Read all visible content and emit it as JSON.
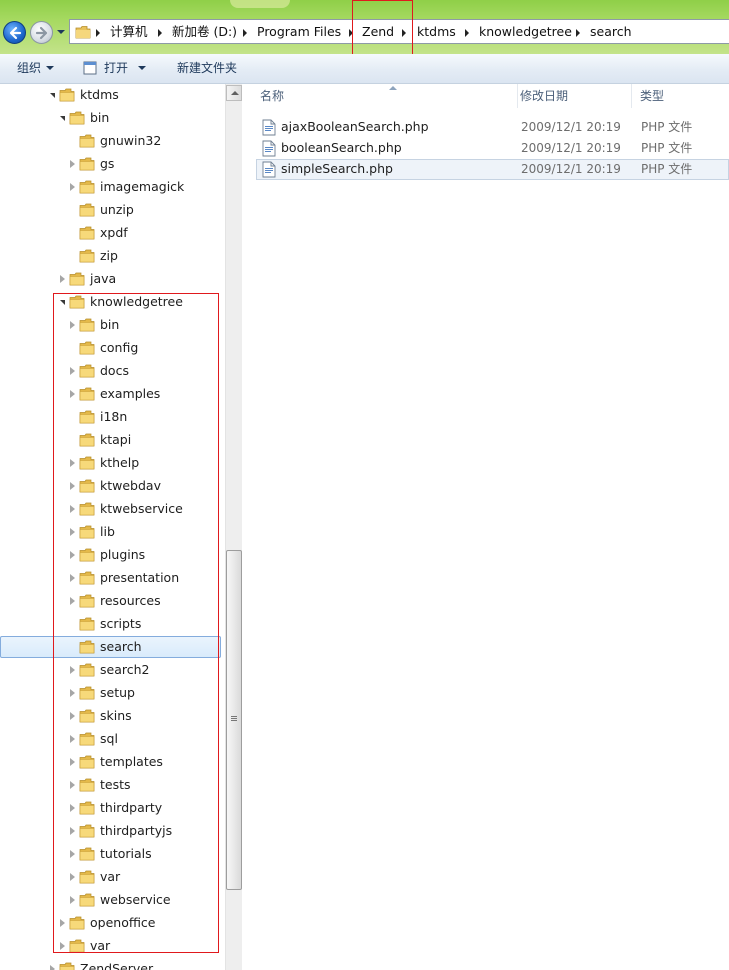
{
  "address": {
    "crumbs": [
      "计算机",
      "新加卷 (D:)",
      "Program Files",
      "Zend",
      "ktdms",
      "knowledgetree",
      "search"
    ]
  },
  "toolbar": {
    "organize": "组织",
    "open": "打开",
    "new_folder": "新建文件夹"
  },
  "tree": {
    "items": [
      {
        "label": "ktdms",
        "state": "expanded"
      },
      {
        "label": "bin",
        "state": "expanded"
      },
      {
        "label": "gnuwin32",
        "state": "none"
      },
      {
        "label": "gs",
        "state": "collapsed"
      },
      {
        "label": "imagemagick",
        "state": "collapsed"
      },
      {
        "label": "unzip",
        "state": "none"
      },
      {
        "label": "xpdf",
        "state": "none"
      },
      {
        "label": "zip",
        "state": "none"
      },
      {
        "label": "java",
        "state": "collapsed"
      },
      {
        "label": "knowledgetree",
        "state": "expanded"
      },
      {
        "label": "bin",
        "state": "collapsed"
      },
      {
        "label": "config",
        "state": "none"
      },
      {
        "label": "docs",
        "state": "collapsed"
      },
      {
        "label": "examples",
        "state": "collapsed"
      },
      {
        "label": "i18n",
        "state": "none"
      },
      {
        "label": "ktapi",
        "state": "none"
      },
      {
        "label": "kthelp",
        "state": "collapsed"
      },
      {
        "label": "ktwebdav",
        "state": "collapsed"
      },
      {
        "label": "ktwebservice",
        "state": "collapsed"
      },
      {
        "label": "lib",
        "state": "collapsed"
      },
      {
        "label": "plugins",
        "state": "collapsed"
      },
      {
        "label": "presentation",
        "state": "collapsed"
      },
      {
        "label": "resources",
        "state": "collapsed"
      },
      {
        "label": "scripts",
        "state": "none"
      },
      {
        "label": "search",
        "state": "none"
      },
      {
        "label": "search2",
        "state": "collapsed"
      },
      {
        "label": "setup",
        "state": "collapsed"
      },
      {
        "label": "skins",
        "state": "collapsed"
      },
      {
        "label": "sql",
        "state": "collapsed"
      },
      {
        "label": "templates",
        "state": "collapsed"
      },
      {
        "label": "tests",
        "state": "collapsed"
      },
      {
        "label": "thirdparty",
        "state": "collapsed"
      },
      {
        "label": "thirdpartyjs",
        "state": "collapsed"
      },
      {
        "label": "tutorials",
        "state": "collapsed"
      },
      {
        "label": "var",
        "state": "collapsed"
      },
      {
        "label": "webservice",
        "state": "collapsed"
      },
      {
        "label": "openoffice",
        "state": "collapsed"
      },
      {
        "label": "var",
        "state": "collapsed"
      },
      {
        "label": "ZendServer",
        "state": "collapsed"
      }
    ]
  },
  "columns": {
    "name": "名称",
    "modified": "修改日期",
    "type": "类型"
  },
  "files": [
    {
      "name": "ajaxBooleanSearch.php",
      "modified": "2009/12/1 20:19",
      "type": "PHP 文件"
    },
    {
      "name": "booleanSearch.php",
      "modified": "2009/12/1 20:19",
      "type": "PHP 文件"
    },
    {
      "name": "simpleSearch.php",
      "modified": "2009/12/1 20:19",
      "type": "PHP 文件"
    }
  ],
  "colors": {
    "highlight_box": "#e0191d",
    "selection_border": "#84acdd",
    "title_green": "#8fcf48"
  }
}
